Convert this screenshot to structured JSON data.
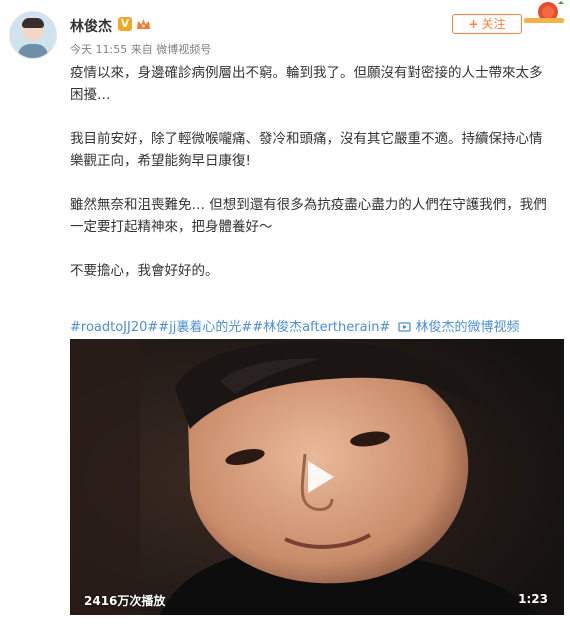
{
  "user": {
    "name": "林俊杰",
    "verified_badge": "V",
    "follow_label": "关注"
  },
  "meta": {
    "text": "今天 11:55 来自 微博视频号"
  },
  "post": {
    "paragraphs": [
      "疫情以來，身邊確診病例層出不窮。輪到我了。但願沒有對密接的人士帶來太多困擾…",
      "我目前安好，除了輕微喉嚨痛、發冷和頭痛，沒有其它嚴重不適。持續保持心情樂觀正向，希望能夠早日康復!",
      "雖然無奈和沮喪難免… 但想到還有很多為抗疫盡心盡力的人們在守護我們，我們一定要打起精神來，把身體養好～",
      "不要擔心，我會好好的。"
    ]
  },
  "tags": {
    "hashtags": "#roadtoJJ20##jj裏着心的光##林俊杰aftertherain#",
    "video_link": "林俊杰的微博视频"
  },
  "video": {
    "play_count": "2416万次播放",
    "duration": "1:23"
  },
  "icons": {
    "verified": "verified-v-icon",
    "vip": "crown-icon",
    "play": "play-icon",
    "video_link": "video-icon"
  },
  "colors": {
    "accent_orange": "#ff8140",
    "link_blue": "#4c8fd6",
    "badge_gold": "#f5a623"
  }
}
